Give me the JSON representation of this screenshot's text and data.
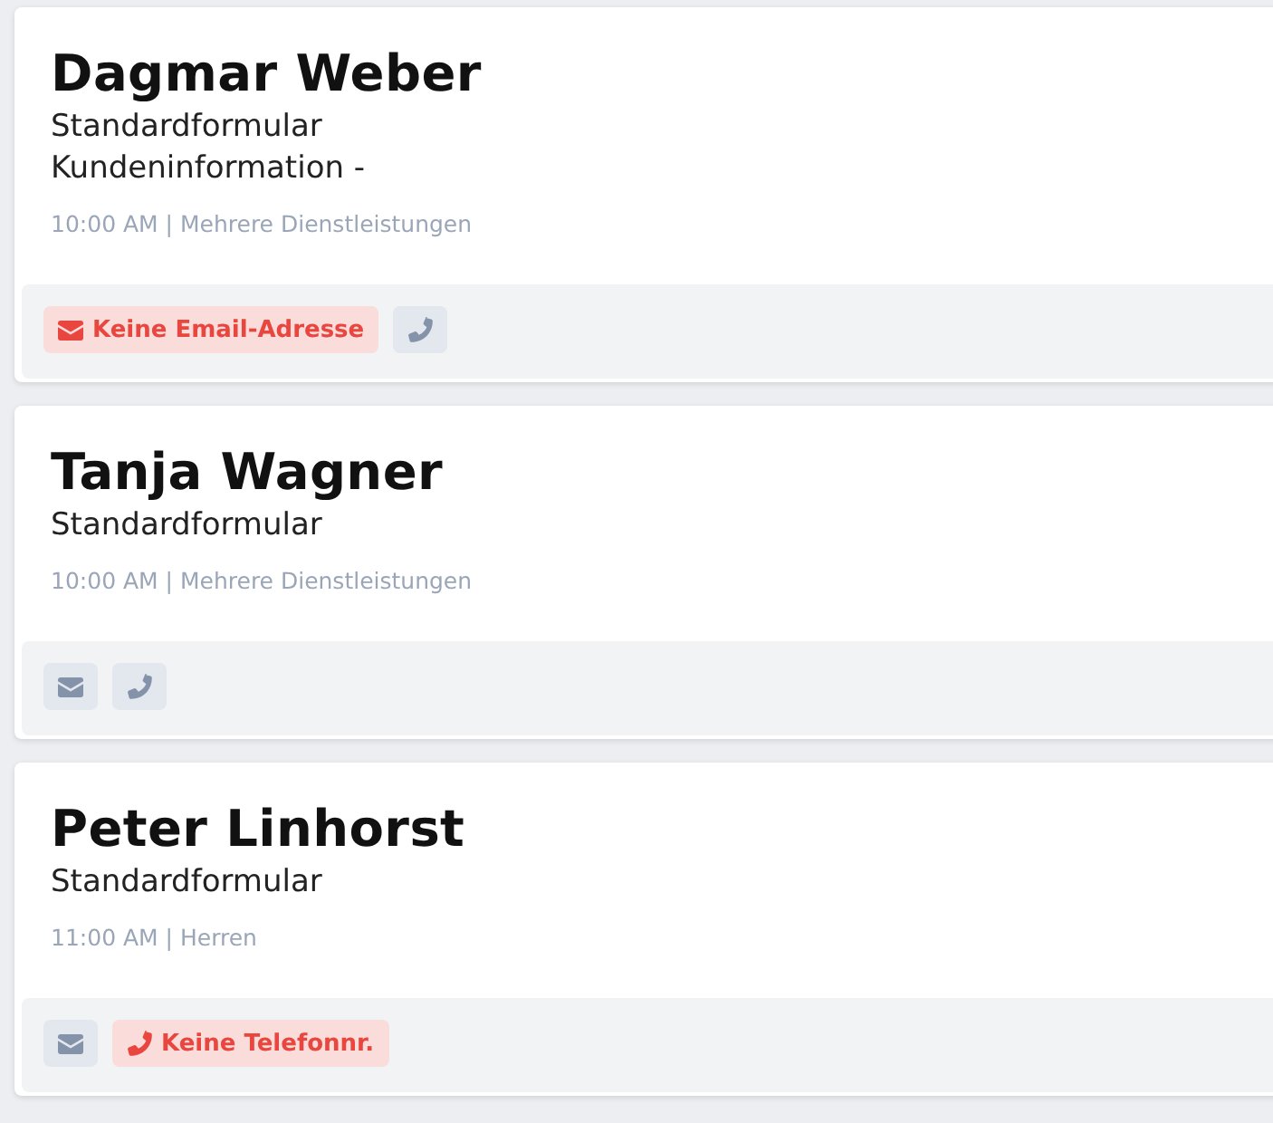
{
  "appointments": [
    {
      "name": "Dagmar Weber",
      "form_lines": [
        "Standardformular",
        "Kundeninformation -"
      ],
      "meta": "10:00 AM | Mehrere Dienstleistungen",
      "contacts": [
        {
          "kind": "email",
          "missing": true,
          "label": "Keine Email-Adresse"
        },
        {
          "kind": "phone",
          "missing": false
        }
      ]
    },
    {
      "name": "Tanja Wagner",
      "form_lines": [
        "Standardformular"
      ],
      "meta": "10:00 AM | Mehrere Dienstleistungen",
      "contacts": [
        {
          "kind": "email",
          "missing": false
        },
        {
          "kind": "phone",
          "missing": false
        }
      ]
    },
    {
      "name": "Peter Linhorst",
      "form_lines": [
        "Standardformular"
      ],
      "meta": "11:00 AM | Herren",
      "contacts": [
        {
          "kind": "email",
          "missing": false
        },
        {
          "kind": "phone",
          "missing": true,
          "label": "Keine Telefonnr."
        }
      ]
    }
  ]
}
